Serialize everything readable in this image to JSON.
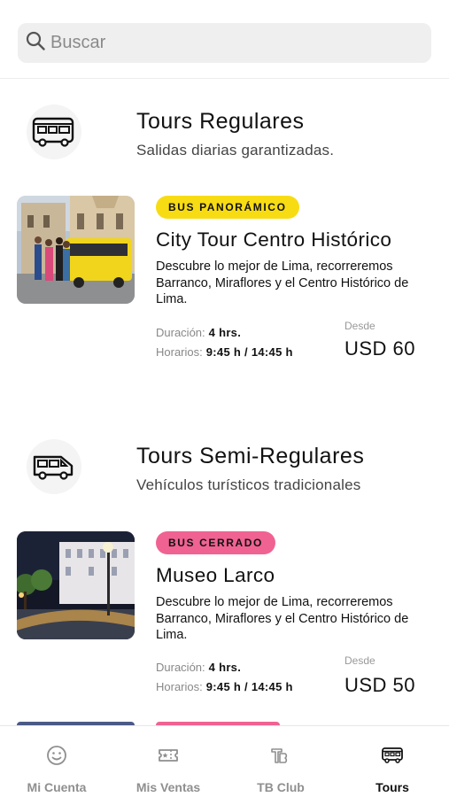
{
  "search": {
    "placeholder": "Buscar",
    "icon": "search-icon"
  },
  "sections": [
    {
      "title": "Tours Regulares",
      "subtitle": "Salidas diarias garantizadas.",
      "icon": "bus-icon",
      "card": {
        "badge": "BUS PANORÁMICO",
        "badge_color": "#F7DC14",
        "title": "City Tour Centro Histórico",
        "description": "Descubre lo mejor de Lima, recorreremos Barranco, Miraflores y el Centro Histórico de Lima.",
        "duration_label": "Duración:",
        "duration_value": "4 hrs.",
        "schedule_label": "Horarios:",
        "schedule_value": "9:45 h / 14:45 h",
        "price_label": "Desde",
        "price_value": "USD 60",
        "image": "city-tour-photo"
      }
    },
    {
      "title": "Tours Semi-Regulares",
      "subtitle": "Vehículos turísticos tradicionales",
      "icon": "van-icon",
      "card": {
        "badge": "BUS CERRADO",
        "badge_color": "#F06292",
        "title": "Museo Larco",
        "description": "Descubre lo mejor de Lima, recorreremos Barranco, Miraflores y el Centro Histórico de Lima.",
        "duration_label": "Duración:",
        "duration_value": "4 hrs.",
        "schedule_label": "Horarios:",
        "schedule_value": "9:45 h / 14:45 h",
        "price_label": "Desde",
        "price_value": "USD 50",
        "image": "museo-larco-photo"
      }
    }
  ],
  "bottom_nav": {
    "items": [
      {
        "label": "Mi Cuenta",
        "icon": "smiley-icon",
        "active": false
      },
      {
        "label": "Mis Ventas",
        "icon": "ticket-icon",
        "active": false
      },
      {
        "label": "TB Club",
        "icon": "tb-logo-icon",
        "active": false
      },
      {
        "label": "Tours",
        "icon": "bus-icon",
        "active": true
      }
    ]
  },
  "colors": {
    "accent_yellow": "#F7DC14",
    "accent_pink": "#F06292",
    "nav_inactive": "#8F8F8F",
    "nav_active": "#111111"
  }
}
